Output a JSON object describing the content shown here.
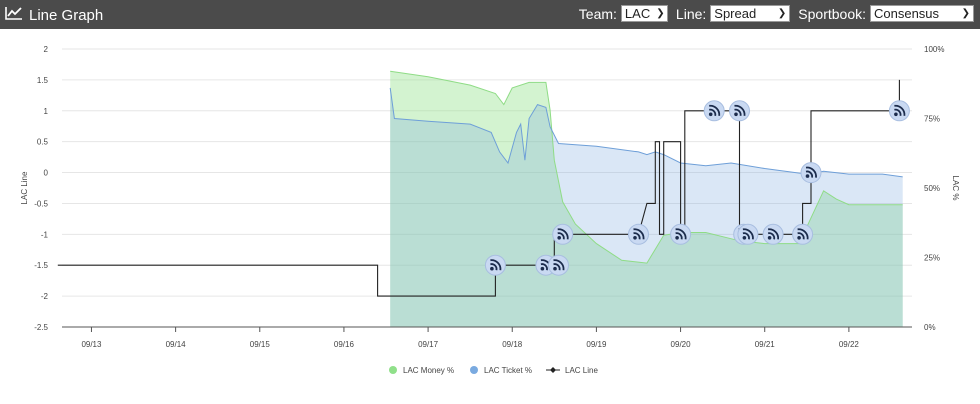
{
  "header": {
    "title": "Line Graph",
    "team_label": "Team:",
    "team_value": "LAC",
    "line_label": "Line:",
    "line_value": "Spread",
    "sportsbook_label": "Sportbook:",
    "sportsbook_value": "Consensus"
  },
  "chart_data": {
    "type": "line",
    "x_ticks": [
      "09/13",
      "09/14",
      "09/15",
      "09/16",
      "09/17",
      "09/18",
      "09/19",
      "09/20",
      "09/21",
      "09/22"
    ],
    "y_left": {
      "label": "LAC Line",
      "ticks": [
        2,
        1.5,
        1,
        0.5,
        0,
        -0.5,
        -1,
        -1.5,
        -2,
        -2.5
      ],
      "ylim": [
        -2.5,
        2
      ]
    },
    "y_right": {
      "label": "LAC %",
      "ticks": [
        "100%",
        "75%",
        "50%",
        "25%",
        "0%"
      ],
      "ylim": [
        0,
        100
      ]
    },
    "legend": [
      "LAC Money %",
      "LAC Ticket %",
      "LAC Line"
    ],
    "colors": {
      "money": "#90e08a",
      "ticket": "#7aaae0",
      "line": "#222222"
    },
    "series": [
      {
        "name": "LAC Money %",
        "points": [
          [
            16.55,
            92
          ],
          [
            17.0,
            90
          ],
          [
            17.5,
            87
          ],
          [
            17.8,
            84
          ],
          [
            17.9,
            80
          ],
          [
            18.0,
            86
          ],
          [
            18.2,
            88
          ],
          [
            18.4,
            88
          ],
          [
            18.45,
            78
          ],
          [
            18.5,
            60
          ],
          [
            18.6,
            45
          ],
          [
            18.75,
            37
          ],
          [
            19.0,
            30
          ],
          [
            19.3,
            24
          ],
          [
            19.6,
            23
          ],
          [
            19.7,
            28
          ],
          [
            19.8,
            33
          ],
          [
            20.0,
            34
          ],
          [
            20.3,
            34
          ],
          [
            20.7,
            31
          ],
          [
            21.0,
            30
          ],
          [
            21.4,
            30
          ],
          [
            21.5,
            36
          ],
          [
            21.7,
            49
          ],
          [
            21.85,
            46
          ],
          [
            22.0,
            44
          ],
          [
            22.4,
            44
          ],
          [
            22.64,
            44
          ]
        ]
      },
      {
        "name": "LAC Ticket %",
        "points": [
          [
            16.55,
            86
          ],
          [
            16.6,
            75
          ],
          [
            17.0,
            74
          ],
          [
            17.5,
            73
          ],
          [
            17.75,
            70
          ],
          [
            17.85,
            63
          ],
          [
            17.95,
            59
          ],
          [
            18.05,
            70
          ],
          [
            18.1,
            73
          ],
          [
            18.15,
            60
          ],
          [
            18.2,
            75
          ],
          [
            18.3,
            80
          ],
          [
            18.4,
            79
          ],
          [
            18.45,
            72
          ],
          [
            18.55,
            66
          ],
          [
            19.0,
            65
          ],
          [
            19.5,
            63
          ],
          [
            19.6,
            62
          ],
          [
            19.7,
            63
          ],
          [
            19.8,
            62
          ],
          [
            20.0,
            59
          ],
          [
            20.3,
            58
          ],
          [
            20.6,
            59
          ],
          [
            21.0,
            57
          ],
          [
            21.5,
            55
          ],
          [
            21.7,
            56
          ],
          [
            22.0,
            55
          ],
          [
            22.4,
            55
          ],
          [
            22.64,
            54
          ]
        ]
      },
      {
        "name": "LAC Line",
        "steps": [
          [
            12.6,
            -1.5
          ],
          [
            16.4,
            -1.5
          ],
          [
            16.4,
            -2
          ],
          [
            17.8,
            -2
          ],
          [
            17.8,
            -1.5
          ],
          [
            18.5,
            -1.5
          ],
          [
            18.5,
            -1
          ],
          [
            19.5,
            -1
          ],
          [
            19.6,
            -0.5
          ],
          [
            19.7,
            -0.5
          ],
          [
            19.7,
            0.5
          ],
          [
            19.75,
            0.5
          ],
          [
            19.75,
            -1
          ],
          [
            19.8,
            -1
          ],
          [
            19.8,
            0.5
          ],
          [
            20.0,
            0.5
          ],
          [
            20.0,
            -1
          ],
          [
            20.05,
            -1
          ],
          [
            20.05,
            1
          ],
          [
            20.7,
            1
          ],
          [
            20.7,
            -1
          ],
          [
            21.45,
            -1
          ],
          [
            21.45,
            -0.5
          ],
          [
            21.55,
            -0.5
          ],
          [
            21.55,
            1
          ],
          [
            22.6,
            1
          ],
          [
            22.6,
            1.5
          ]
        ]
      }
    ],
    "markers": [
      [
        17.8,
        -1.5
      ],
      [
        18.4,
        -1.5
      ],
      [
        18.55,
        -1.5
      ],
      [
        18.6,
        -1
      ],
      [
        19.5,
        -1
      ],
      [
        20.0,
        -1
      ],
      [
        20.4,
        1
      ],
      [
        20.7,
        1
      ],
      [
        20.75,
        -1
      ],
      [
        20.8,
        -1
      ],
      [
        21.1,
        -1
      ],
      [
        21.45,
        -1
      ],
      [
        21.55,
        0
      ],
      [
        22.6,
        1
      ]
    ]
  }
}
